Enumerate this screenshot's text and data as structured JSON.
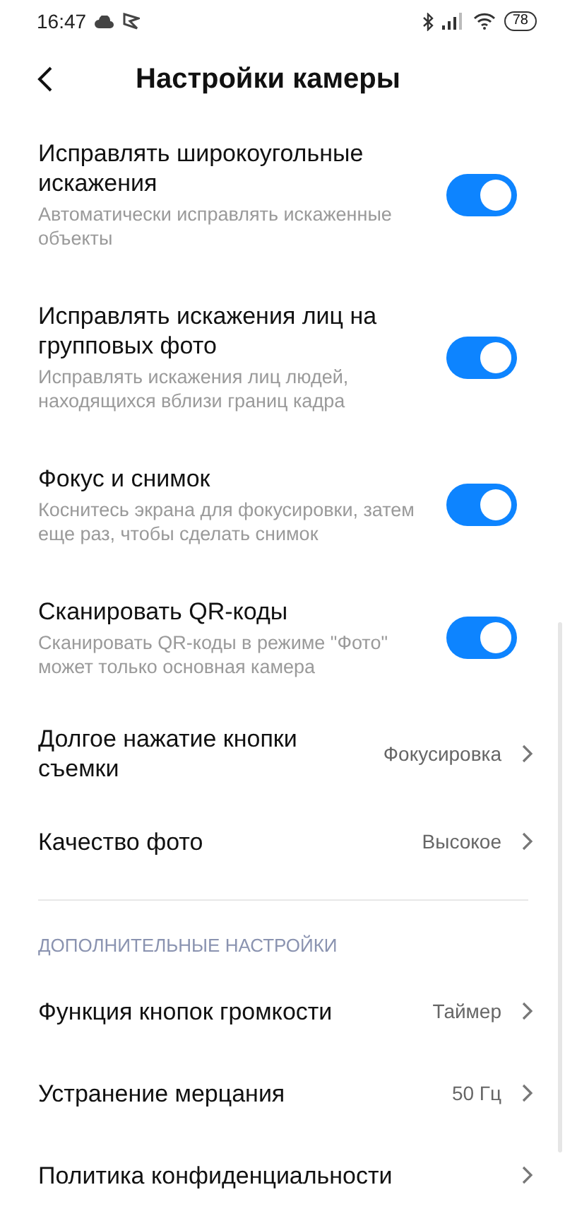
{
  "status_bar": {
    "time": "16:47",
    "battery": "78"
  },
  "header": {
    "title": "Настройки камеры"
  },
  "items": [
    {
      "kind": "toggle",
      "title": "Исправлять широкоугольные искажения",
      "subtitle": "Автоматически исправлять искаженные объекты",
      "on": true
    },
    {
      "kind": "toggle",
      "title": "Исправлять искажения лиц на групповых фото",
      "subtitle": "Исправлять искажения лиц людей, находящихся вблизи границ кадра",
      "on": true
    },
    {
      "kind": "toggle",
      "title": "Фокус и снимок",
      "subtitle": "Коснитесь экрана для фокусировки, затем еще раз, чтобы сделать снимок",
      "on": true
    },
    {
      "kind": "toggle",
      "title": "Сканировать QR-коды",
      "subtitle": "Сканировать QR-коды в режиме \"Фото\" может только основная камера",
      "on": true
    },
    {
      "kind": "nav",
      "title": "Долгое нажатие кнопки съемки",
      "value": "Фокусировка"
    },
    {
      "kind": "nav",
      "title": "Качество фото",
      "value": "Высокое"
    },
    {
      "kind": "divider"
    },
    {
      "kind": "section",
      "title": "ДОПОЛНИТЕЛЬНЫЕ НАСТРОЙКИ"
    },
    {
      "kind": "nav",
      "title": "Функция кнопок громкости",
      "value": "Таймер"
    },
    {
      "kind": "nav",
      "title": "Устранение мерцания",
      "value": "50 Гц"
    },
    {
      "kind": "nav",
      "title": "Политика конфиденциальности"
    }
  ]
}
